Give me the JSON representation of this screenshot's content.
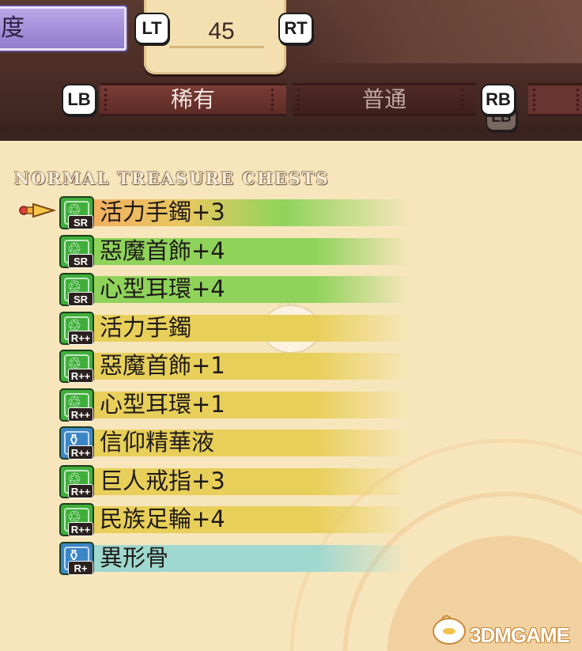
{
  "header": {
    "mode_label": "度",
    "counter": "45",
    "left_trigger": "LT",
    "right_trigger": "RT",
    "left_bumper": "LB",
    "right_bumper": "RB",
    "ghost_bumper": "LB"
  },
  "tabs": [
    {
      "label": "稀有",
      "active": true
    },
    {
      "label": "普通",
      "active": false
    }
  ],
  "section": {
    "title": "NORMAL TREASURE CHESTS"
  },
  "items": [
    {
      "name": "活力手鐲+3",
      "rank": "SR",
      "icon": "ring-icon",
      "stripe": "#8fd35a",
      "icon_color": "#3fae3a",
      "selected": true
    },
    {
      "name": "惡魔首飾+4",
      "rank": "SR",
      "icon": "ring-icon",
      "stripe": "#8fd35a",
      "icon_color": "#3fae3a",
      "selected": false
    },
    {
      "name": "心型耳環+4",
      "rank": "SR",
      "icon": "ring-icon",
      "stripe": "#8fd35a",
      "icon_color": "#3fae3a",
      "selected": false
    },
    {
      "name": "活力手鐲",
      "rank": "R++",
      "icon": "ring-icon",
      "stripe": "#e8cf5a",
      "icon_color": "#3fae3a",
      "selected": false
    },
    {
      "name": "惡魔首飾+1",
      "rank": "R++",
      "icon": "ring-icon",
      "stripe": "#e8cf5a",
      "icon_color": "#3fae3a",
      "selected": false
    },
    {
      "name": "心型耳環+1",
      "rank": "R++",
      "icon": "ring-icon",
      "stripe": "#e8cf5a",
      "icon_color": "#3fae3a",
      "selected": false
    },
    {
      "name": "信仰精華液",
      "rank": "R++",
      "icon": "potion-icon",
      "stripe": "#e8cf5a",
      "icon_color": "#3b86c6",
      "selected": false
    },
    {
      "name": "巨人戒指+3",
      "rank": "R++",
      "icon": "ring-icon",
      "stripe": "#e8cf5a",
      "icon_color": "#3fae3a",
      "selected": false
    },
    {
      "name": "民族足輪+4",
      "rank": "R++",
      "icon": "ring-icon",
      "stripe": "#e8cf5a",
      "icon_color": "#3fae3a",
      "selected": false
    },
    {
      "name": "異形骨",
      "rank": "R+",
      "icon": "potion-icon",
      "stripe": "#9fd8cf",
      "icon_color": "#3b86c6",
      "selected": false
    }
  ],
  "watermark": "3DMGAME"
}
